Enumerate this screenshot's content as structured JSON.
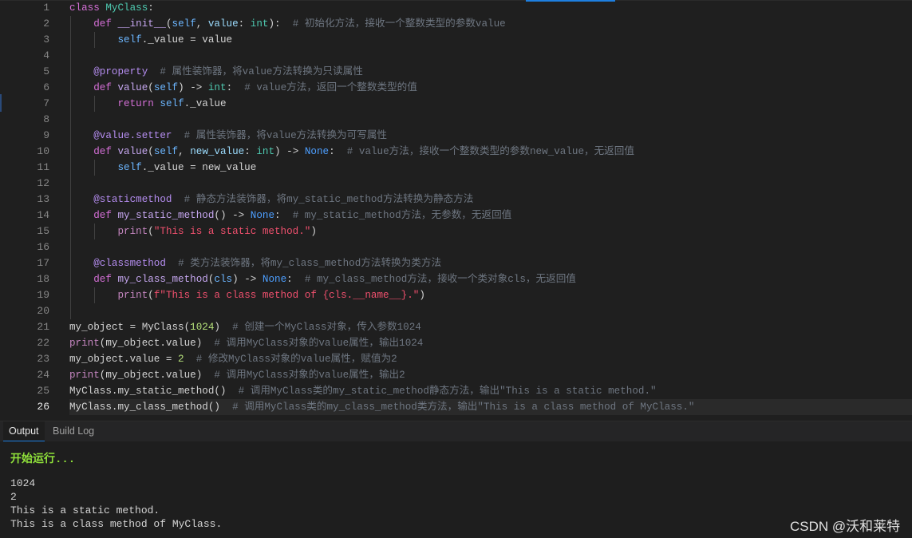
{
  "editor": {
    "current_line": 26,
    "lines": [
      {
        "n": "1",
        "tokens": [
          {
            "t": "k",
            "v": "class"
          },
          {
            "t": "x",
            "v": " "
          },
          {
            "t": "c",
            "v": "MyClass"
          },
          {
            "t": "x",
            "v": ":"
          }
        ]
      },
      {
        "n": "2",
        "tokens": [
          {
            "t": "x",
            "v": "    "
          },
          {
            "t": "k",
            "v": "def"
          },
          {
            "t": "x",
            "v": " "
          },
          {
            "t": "f",
            "v": "__init__"
          },
          {
            "t": "x",
            "v": "("
          },
          {
            "t": "s",
            "v": "self"
          },
          {
            "t": "x",
            "v": ", "
          },
          {
            "t": "p",
            "v": "value"
          },
          {
            "t": "x",
            "v": ": "
          },
          {
            "t": "t",
            "v": "int"
          },
          {
            "t": "x",
            "v": "):  "
          },
          {
            "t": "cm",
            "v": "# 初始化方法，接收一个整数类型的参数value"
          }
        ]
      },
      {
        "n": "3",
        "tokens": [
          {
            "t": "x",
            "v": "        "
          },
          {
            "t": "s",
            "v": "self"
          },
          {
            "t": "x",
            "v": "._value = value"
          }
        ]
      },
      {
        "n": "4",
        "tokens": []
      },
      {
        "n": "5",
        "tokens": [
          {
            "t": "x",
            "v": "    "
          },
          {
            "t": "d",
            "v": "@property"
          },
          {
            "t": "x",
            "v": "  "
          },
          {
            "t": "cm",
            "v": "# 属性装饰器，将value方法转换为只读属性"
          }
        ]
      },
      {
        "n": "6",
        "tokens": [
          {
            "t": "x",
            "v": "    "
          },
          {
            "t": "k",
            "v": "def"
          },
          {
            "t": "x",
            "v": " "
          },
          {
            "t": "f",
            "v": "value"
          },
          {
            "t": "x",
            "v": "("
          },
          {
            "t": "s",
            "v": "self"
          },
          {
            "t": "x",
            "v": ") -> "
          },
          {
            "t": "t",
            "v": "int"
          },
          {
            "t": "x",
            "v": ":  "
          },
          {
            "t": "cm",
            "v": "# value方法，返回一个整数类型的值"
          }
        ]
      },
      {
        "n": "7",
        "tokens": [
          {
            "t": "x",
            "v": "        "
          },
          {
            "t": "k",
            "v": "return"
          },
          {
            "t": "x",
            "v": " "
          },
          {
            "t": "s",
            "v": "self"
          },
          {
            "t": "x",
            "v": "._value"
          }
        ]
      },
      {
        "n": "8",
        "tokens": []
      },
      {
        "n": "9",
        "tokens": [
          {
            "t": "x",
            "v": "    "
          },
          {
            "t": "d",
            "v": "@value.setter"
          },
          {
            "t": "x",
            "v": "  "
          },
          {
            "t": "cm",
            "v": "# 属性装饰器，将value方法转换为可写属性"
          }
        ]
      },
      {
        "n": "10",
        "tokens": [
          {
            "t": "x",
            "v": "    "
          },
          {
            "t": "k",
            "v": "def"
          },
          {
            "t": "x",
            "v": " "
          },
          {
            "t": "f",
            "v": "value"
          },
          {
            "t": "x",
            "v": "("
          },
          {
            "t": "s",
            "v": "self"
          },
          {
            "t": "x",
            "v": ", "
          },
          {
            "t": "p",
            "v": "new_value"
          },
          {
            "t": "x",
            "v": ": "
          },
          {
            "t": "t",
            "v": "int"
          },
          {
            "t": "x",
            "v": ") -> "
          },
          {
            "t": "n",
            "v": "None"
          },
          {
            "t": "x",
            "v": ":  "
          },
          {
            "t": "cm",
            "v": "# value方法，接收一个整数类型的参数new_value，无返回值"
          }
        ]
      },
      {
        "n": "11",
        "tokens": [
          {
            "t": "x",
            "v": "        "
          },
          {
            "t": "s",
            "v": "self"
          },
          {
            "t": "x",
            "v": "._value = new_value"
          }
        ]
      },
      {
        "n": "12",
        "tokens": []
      },
      {
        "n": "13",
        "tokens": [
          {
            "t": "x",
            "v": "    "
          },
          {
            "t": "d",
            "v": "@staticmethod"
          },
          {
            "t": "x",
            "v": "  "
          },
          {
            "t": "cm",
            "v": "# 静态方法装饰器，将my_static_method方法转换为静态方法"
          }
        ]
      },
      {
        "n": "14",
        "tokens": [
          {
            "t": "x",
            "v": "    "
          },
          {
            "t": "k",
            "v": "def"
          },
          {
            "t": "x",
            "v": " "
          },
          {
            "t": "f",
            "v": "my_static_method"
          },
          {
            "t": "x",
            "v": "() -> "
          },
          {
            "t": "n",
            "v": "None"
          },
          {
            "t": "x",
            "v": ":  "
          },
          {
            "t": "cm",
            "v": "# my_static_method方法，无参数，无返回值"
          }
        ]
      },
      {
        "n": "15",
        "tokens": [
          {
            "t": "x",
            "v": "        "
          },
          {
            "t": "b",
            "v": "print"
          },
          {
            "t": "x",
            "v": "("
          },
          {
            "t": "str",
            "v": "\"This is a static method.\""
          },
          {
            "t": "x",
            "v": ")"
          }
        ]
      },
      {
        "n": "16",
        "tokens": []
      },
      {
        "n": "17",
        "tokens": [
          {
            "t": "x",
            "v": "    "
          },
          {
            "t": "d",
            "v": "@classmethod"
          },
          {
            "t": "x",
            "v": "  "
          },
          {
            "t": "cm",
            "v": "# 类方法装饰器，将my_class_method方法转换为类方法"
          }
        ]
      },
      {
        "n": "18",
        "tokens": [
          {
            "t": "x",
            "v": "    "
          },
          {
            "t": "k",
            "v": "def"
          },
          {
            "t": "x",
            "v": " "
          },
          {
            "t": "f",
            "v": "my_class_method"
          },
          {
            "t": "x",
            "v": "("
          },
          {
            "t": "s",
            "v": "cls"
          },
          {
            "t": "x",
            "v": ") -> "
          },
          {
            "t": "n",
            "v": "None"
          },
          {
            "t": "x",
            "v": ":  "
          },
          {
            "t": "cm",
            "v": "# my_class_method方法，接收一个类对象cls，无返回值"
          }
        ]
      },
      {
        "n": "19",
        "tokens": [
          {
            "t": "x",
            "v": "        "
          },
          {
            "t": "b",
            "v": "print"
          },
          {
            "t": "x",
            "v": "("
          },
          {
            "t": "str",
            "v": "f\"This is a class method of {cls.__name__}.\""
          },
          {
            "t": "x",
            "v": ")"
          }
        ]
      },
      {
        "n": "20",
        "tokens": []
      },
      {
        "n": "21",
        "tokens": [
          {
            "t": "x",
            "v": "my_object = MyClass("
          },
          {
            "t": "num",
            "v": "1024"
          },
          {
            "t": "x",
            "v": ")  "
          },
          {
            "t": "cm",
            "v": "# 创建一个MyClass对象，传入参数1024"
          }
        ]
      },
      {
        "n": "22",
        "tokens": [
          {
            "t": "b",
            "v": "print"
          },
          {
            "t": "x",
            "v": "(my_object.value)  "
          },
          {
            "t": "cm",
            "v": "# 调用MyClass对象的value属性，输出1024"
          }
        ]
      },
      {
        "n": "23",
        "tokens": [
          {
            "t": "x",
            "v": "my_object.value = "
          },
          {
            "t": "num",
            "v": "2"
          },
          {
            "t": "x",
            "v": "  "
          },
          {
            "t": "cm",
            "v": "# 修改MyClass对象的value属性，赋值为2"
          }
        ]
      },
      {
        "n": "24",
        "tokens": [
          {
            "t": "b",
            "v": "print"
          },
          {
            "t": "x",
            "v": "(my_object.value)  "
          },
          {
            "t": "cm",
            "v": "# 调用MyClass对象的value属性，输出2"
          }
        ]
      },
      {
        "n": "25",
        "tokens": [
          {
            "t": "x",
            "v": "MyClass.my_static_method()  "
          },
          {
            "t": "cm",
            "v": "# 调用MyClass类的my_static_method静态方法，输出\"This is a static method.\""
          }
        ]
      },
      {
        "n": "26",
        "tokens": [
          {
            "t": "x",
            "v": "MyClass.my_class_method()  "
          },
          {
            "t": "cm",
            "v": "# 调用MyClass类的my_class_method类方法，输出\"This is a class method of MyClass.\""
          }
        ]
      }
    ]
  },
  "panel": {
    "tabs": [
      {
        "label": "Output",
        "active": true
      },
      {
        "label": "Build Log",
        "active": false
      }
    ],
    "start_message": "开始运行...",
    "output_lines": [
      "1024",
      "2",
      "This is a static method.",
      "This is a class method of MyClass."
    ]
  },
  "watermark": "CSDN @沃和莱特",
  "colors": {
    "accent": "#1e7fe0",
    "background": "#1f1f1f",
    "start_message": "#8fe03a"
  }
}
